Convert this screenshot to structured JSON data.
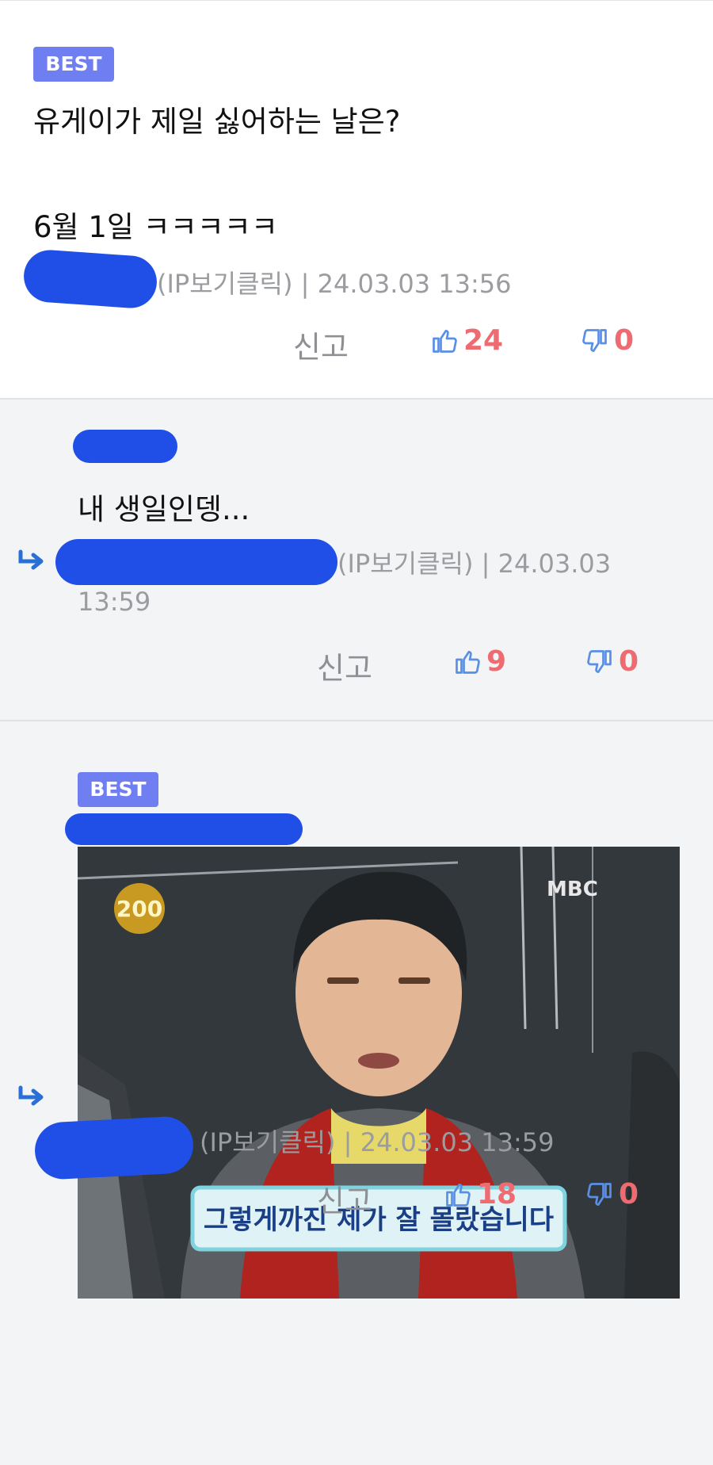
{
  "comments": [
    {
      "badge": "BEST",
      "lines": [
        "유게이가 제일 싫어하는 날은?",
        "6월 1일 ㅋㅋㅋㅋㅋ"
      ],
      "ip_label": "(IP보기클릭)",
      "separator": "|",
      "date": "24.03.03 13:56",
      "report": "신고",
      "likes": "24",
      "dislikes": "0"
    },
    {
      "lines": [
        "내 생일인뎅..."
      ],
      "ip_label": "(IP보기클릭)",
      "separator": "|",
      "date_line1": "24.03.03",
      "date_line2": "13:59",
      "report": "신고",
      "likes": "9",
      "dislikes": "0"
    },
    {
      "badge": "BEST",
      "image": {
        "subtitle": "그렇게까진 제가 잘 몰랐습니다",
        "channel_logo": "MBC",
        "show_logo": "200"
      },
      "ip_label": "(IP보기클릭)",
      "separator": "|",
      "date": "24.03.03 13:59",
      "report": "신고",
      "likes": "18",
      "dislikes": "0"
    }
  ],
  "colors": {
    "badge": "#6f7ef0",
    "vote_count": "#ef6b72",
    "thumb_icon": "#5a8fe6",
    "redaction": "#1f4fe6",
    "reply_arrow": "#2a6fd6"
  },
  "icons": [
    "thumbs-up-icon",
    "thumbs-down-icon",
    "reply-arrow-icon"
  ]
}
